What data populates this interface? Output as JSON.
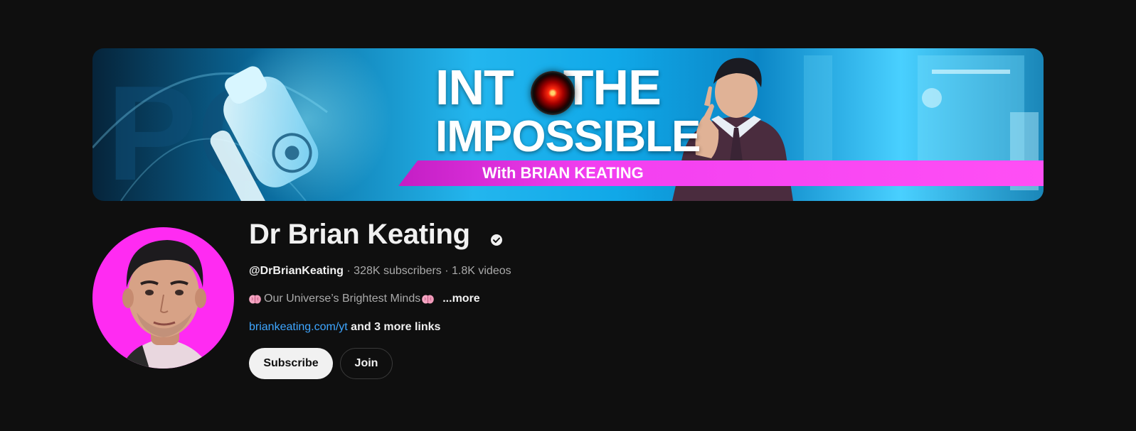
{
  "banner": {
    "line1_a": "INT",
    "line1_b": "THE",
    "line2": "IMPOSSIBLE",
    "strip_text": "With BRIAN KEATING"
  },
  "channel": {
    "name": "Dr Brian Keating",
    "verified_icon": "verified-check-icon",
    "handle": "@DrBrianKeating",
    "separator": " · ",
    "subscribers": "328K subscribers",
    "videos": "1.8K videos",
    "description": "Our Universe’s Brightest Minds",
    "description_icon": "brain-emoji-icon",
    "more_label": "...more",
    "link_text": "briankeating.com/yt",
    "more_links_text": " and 3 more links"
  },
  "actions": {
    "subscribe_label": "Subscribe",
    "join_label": "Join"
  },
  "colors": {
    "background": "#0f0f0f",
    "link": "#3ea6ff",
    "avatar_bg": "#ff2bf2",
    "banner_strip": "#f23ff0"
  }
}
